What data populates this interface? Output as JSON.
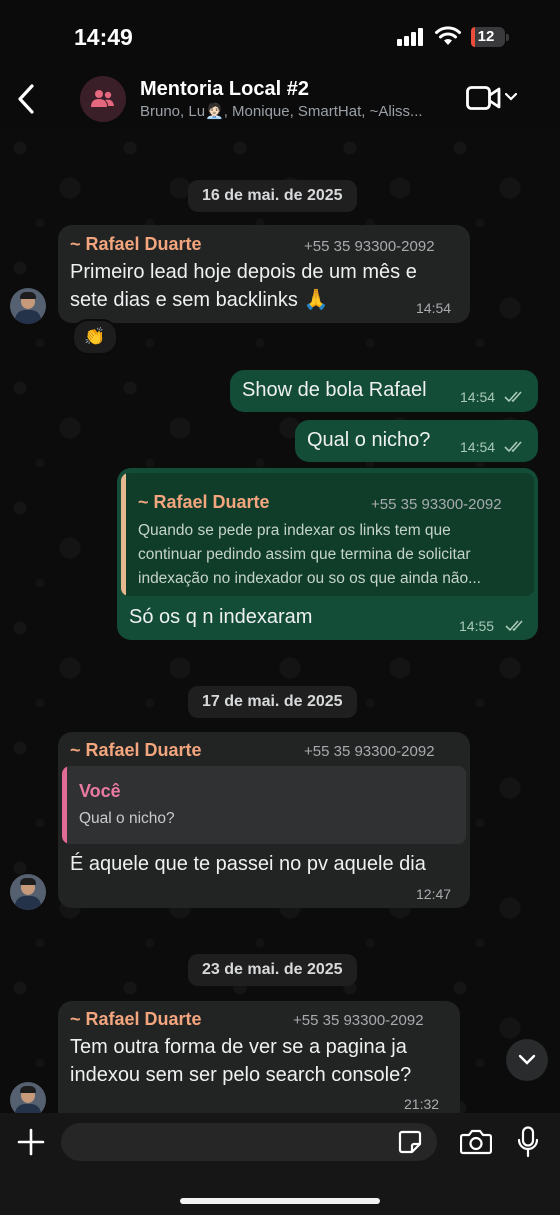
{
  "status_bar": {
    "time": "14:49",
    "battery": "12",
    "battery_level": 0.12
  },
  "header": {
    "title": "Mentoria Local #2",
    "subtitle": "Bruno, Lu🧑🏻‍💼, Monique, SmartHat, ~Aliss...",
    "icons": {
      "back": "chevron-left-icon",
      "avatar": "group-icon",
      "video": "video-camera-icon"
    }
  },
  "chat": {
    "date1": "16 de mai. de 2025",
    "m1": {
      "sender": "~ Rafael Duarte",
      "phone": "+55 35 93300-2092",
      "line1": "Primeiro lead hoje depois de um mês e",
      "line2": "sete dias e sem backlinks 🙏",
      "time": "14:54",
      "reaction": "👏"
    },
    "m2": {
      "text": "Show de bola Rafael",
      "time": "14:54"
    },
    "m3": {
      "text": "Qual o nicho?",
      "time": "14:54"
    },
    "m4": {
      "quote_sender": "~ Rafael Duarte",
      "quote_phone": "+55 35 93300-2092",
      "quote_line1": "Quando se pede pra indexar os links tem que",
      "quote_line2": "continuar pedindo assim que termina de solicitar",
      "quote_line3": "indexação no indexador ou so os que ainda não...",
      "text": "Só os q n indexaram",
      "time": "14:55"
    },
    "date2": "17 de mai. de 2025",
    "m5": {
      "sender": "~ Rafael Duarte",
      "phone": "+55 35 93300-2092",
      "quote_sender": "Você",
      "quote_text": "Qual o nicho?",
      "text": "É aquele que te passei no pv aquele dia",
      "time": "12:47"
    },
    "date3": "23 de mai. de 2025",
    "m6": {
      "sender": "~ Rafael Duarte",
      "phone": "+55 35 93300-2092",
      "line1": "Tem outra forma de ver se a pagina ja",
      "line2": "indexou sem ser pelo search console?",
      "time": "21:32"
    }
  },
  "composer": {
    "placeholder": "",
    "icons": [
      "plus-icon",
      "sticker-icon",
      "camera-icon",
      "microphone-icon"
    ]
  },
  "colors": {
    "incoming": "#222323",
    "outgoing": "#144d37",
    "sender_name": "#f3a57e",
    "quote_you_bar": "#e06b96"
  }
}
